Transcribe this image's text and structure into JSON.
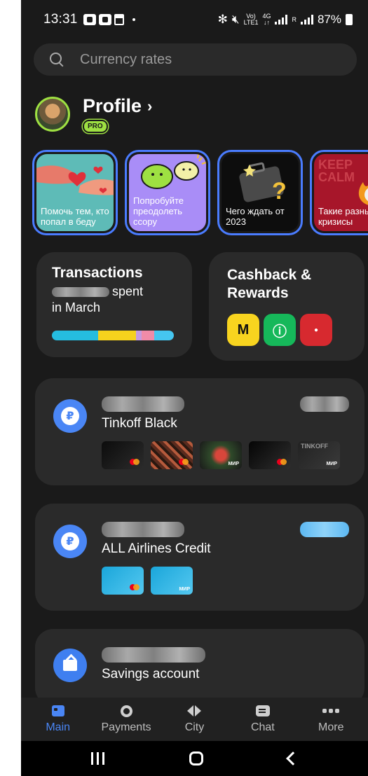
{
  "status_bar": {
    "time": "13:31",
    "net_top": "Vo)",
    "net_bottom": "LTE1",
    "g4_top": "4G",
    "g4_bottom": "↓↑",
    "sim_label": "R",
    "battery": "87%"
  },
  "search": {
    "placeholder": "Currency rates"
  },
  "profile": {
    "title": "Profile",
    "badge": "PRO"
  },
  "stories": [
    {
      "text": "Помочь тем, кто попал в беду",
      "color": "#5ebbb7"
    },
    {
      "text": "Попробуйте преодолеть ссору",
      "color": "#a98df7"
    },
    {
      "text": "Чего ждать от 2023",
      "color": "#0d0d0d"
    },
    {
      "text": "Такие разные кризисы",
      "color": "#a7162a",
      "bg_text": "KEEP CALM"
    }
  ],
  "transactions": {
    "title": "Transactions",
    "spent_label": "spent",
    "period": "in March",
    "bar_colors": [
      "#25bde0",
      "#f6d21d",
      "#c49be0",
      "#f08ba8",
      "#45c6f0"
    ]
  },
  "cashback": {
    "title_line1": "Cashback &",
    "title_line2": "Rewards",
    "partners": [
      {
        "icon": "yandex-m-icon",
        "glyph": "M",
        "bg": "#f8d41f",
        "fg": "#111111"
      },
      {
        "icon": "green-partner-icon",
        "glyph": "ⓘ",
        "bg": "#16b85a",
        "fg": "#ffffff"
      },
      {
        "icon": "red-partner-icon",
        "glyph": "●",
        "bg": "#d7292f",
        "fg": "#ffffff"
      }
    ]
  },
  "accounts": [
    {
      "name": "Tinkoff Black",
      "icon": "ruble-icon",
      "glyph": "₽"
    },
    {
      "name": "ALL Airlines Credit",
      "icon": "ruble-icon",
      "glyph": "₽"
    },
    {
      "name": "Savings account",
      "icon": "savings-icon"
    }
  ],
  "mini_cards": {
    "black": [
      {
        "bg": "linear-gradient(135deg,#0c0c0c,#2b2b2b)",
        "brand": "mastercard"
      },
      {
        "bg": "repeating-linear-gradient(45deg,#5a2b1e 0 4px,#b65a3c 4px 8px,#2a1810 8px 12px)",
        "brand": "mastercard"
      },
      {
        "bg": "radial-gradient(circle,#d8463b 0 20%,#2f4a2a 40%,#1a1a1a)",
        "brand": "mir",
        "label": "МИР"
      },
      {
        "bg": "linear-gradient(135deg,#050505,#2e2e2e)",
        "brand": "mastercard"
      },
      {
        "bg": "linear-gradient(135deg,#222,#3a3a3a)",
        "brand": "mir",
        "label": "МИР",
        "top_text": "TINKOFF"
      }
    ],
    "airlines": [
      {
        "bg": "linear-gradient(135deg,#1aa6da,#54c8f0)",
        "brand": "mastercard"
      },
      {
        "bg": "linear-gradient(135deg,#1aa6da,#54c8f0)",
        "brand": "mir",
        "label": "МИР"
      }
    ]
  },
  "nav": [
    {
      "label": "Main",
      "icon": "main-icon",
      "active": true
    },
    {
      "label": "Payments",
      "icon": "payments-icon"
    },
    {
      "label": "City",
      "icon": "city-icon"
    },
    {
      "label": "Chat",
      "icon": "chat-icon"
    },
    {
      "label": "More",
      "icon": "more-icon"
    }
  ],
  "colors": {
    "accent": "#4a86f5",
    "pro": "#9ee042",
    "background": "#1a1a1a",
    "card": "#2a2a2a"
  }
}
